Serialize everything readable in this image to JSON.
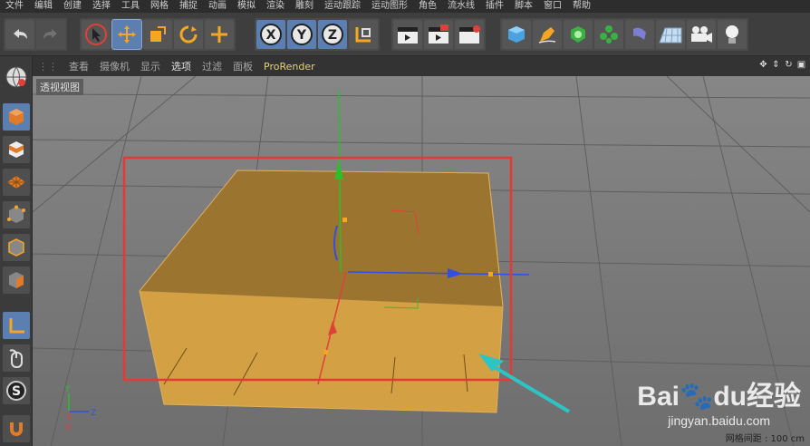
{
  "menu": [
    "文件",
    "编辑",
    "创建",
    "选择",
    "工具",
    "网格",
    "捕捉",
    "动画",
    "模拟",
    "渲染",
    "雕刻",
    "运动跟踪",
    "运动图形",
    "角色",
    "流水线",
    "插件",
    "脚本",
    "窗口",
    "帮助"
  ],
  "toolbar": {
    "undo": "undo-icon",
    "redo": "redo-icon",
    "axis_x": "X",
    "axis_y": "Y",
    "axis_z": "Z"
  },
  "view_menu": [
    "查看",
    "摄像机",
    "显示",
    "选项",
    "过滤",
    "面板",
    "ProRender"
  ],
  "viewport": {
    "label": "透视视图",
    "grid_spacing": "网格间距 : 100 cm",
    "axis_labels": {
      "x": "X",
      "y": "Y",
      "z": "Z"
    }
  },
  "watermark": {
    "brand": "Bai",
    "brand2": "du",
    "suffix": "经验",
    "url": "jingyan.baidu.com"
  },
  "colors": {
    "accent": "#5a7fb0",
    "box_top": "#9b7430",
    "box_front": "#d3a043",
    "highlight": "#e53935",
    "arrow": "#2ec4c4"
  }
}
